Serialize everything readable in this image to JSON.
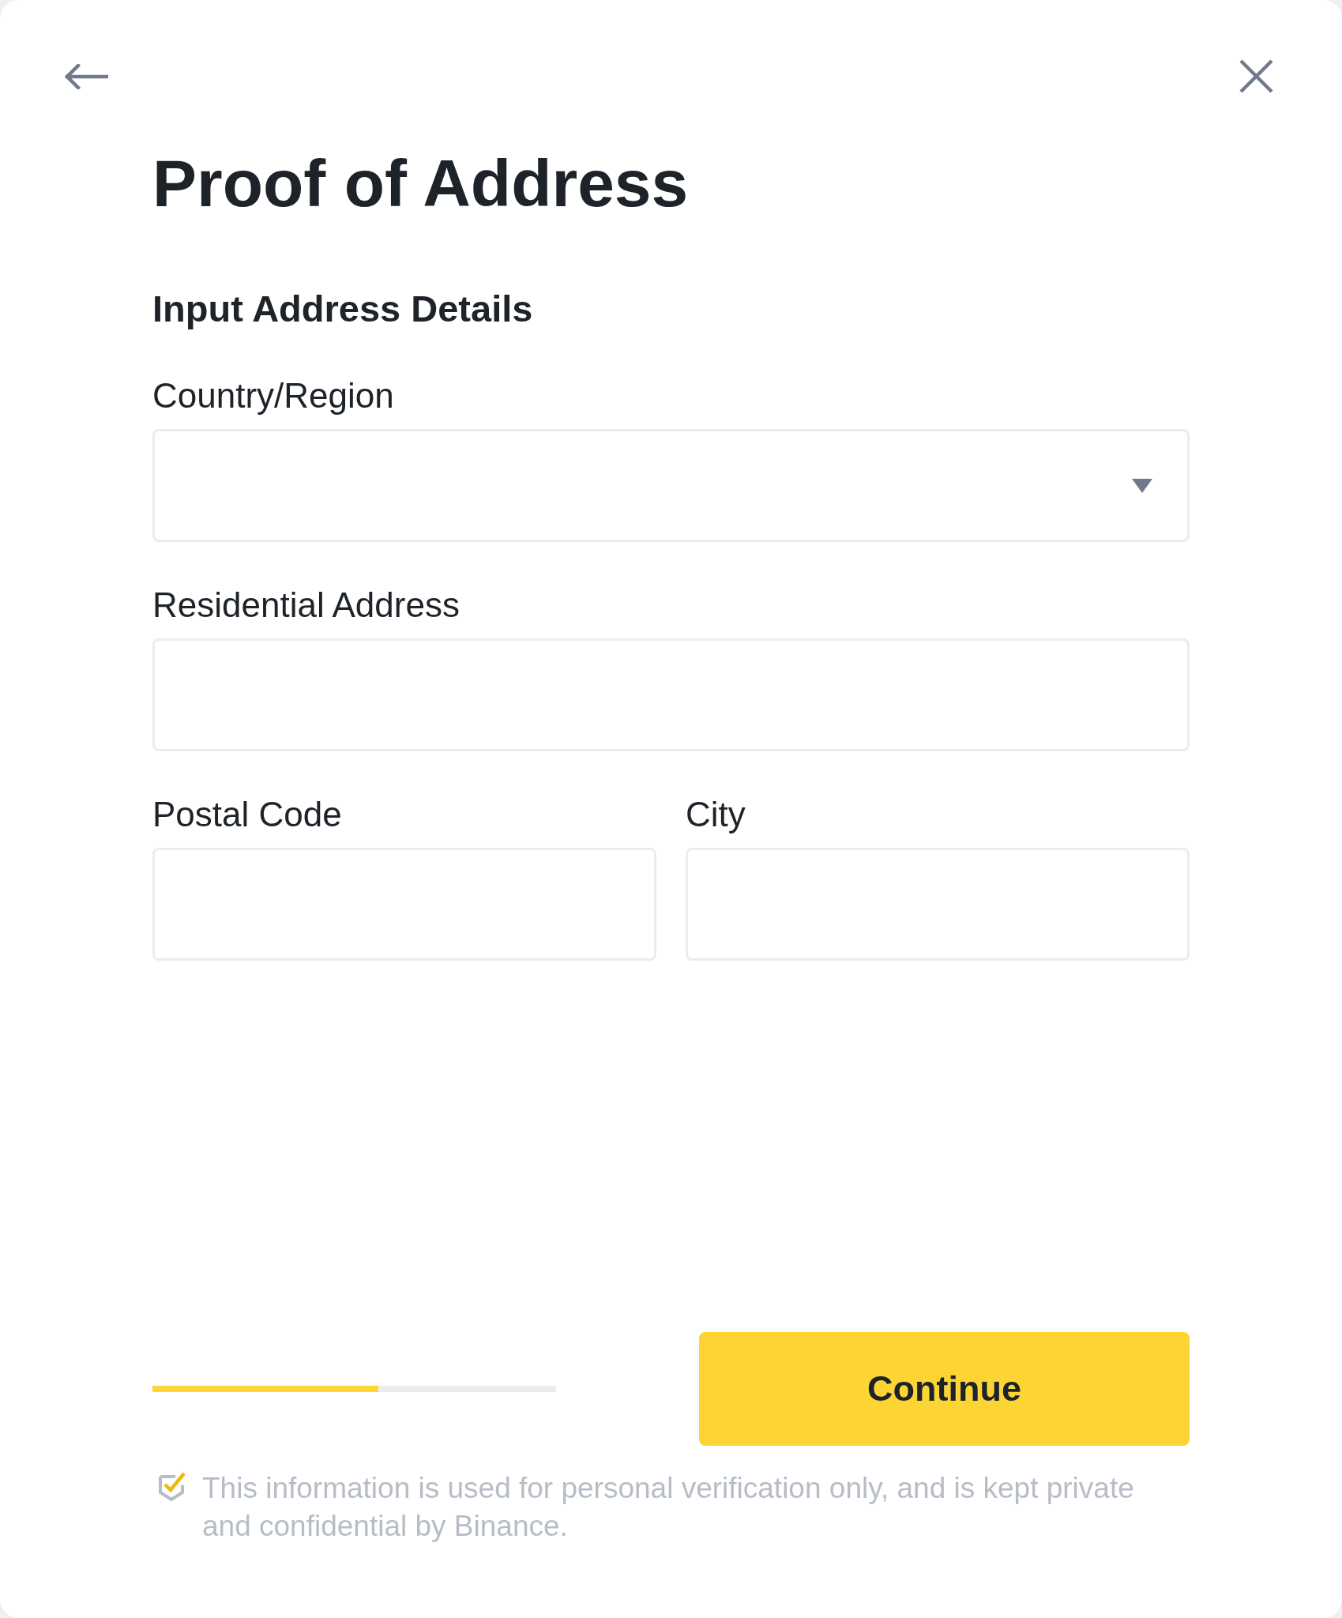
{
  "title": "Proof of Address",
  "section_title": "Input Address Details",
  "rows": [
    [
      {
        "kind": "select",
        "label": "Country/Region"
      }
    ],
    [
      {
        "kind": "text",
        "label": "Residential Address"
      }
    ],
    [
      {
        "kind": "text",
        "label": "Postal Code"
      },
      {
        "kind": "text",
        "label": "City"
      }
    ]
  ],
  "progress": {
    "level": 0.56
  },
  "continue_button": {
    "label": "Continue"
  },
  "notice": {
    "text": "This information is used for personal verification only, and is kept private and confidential by Binance."
  }
}
